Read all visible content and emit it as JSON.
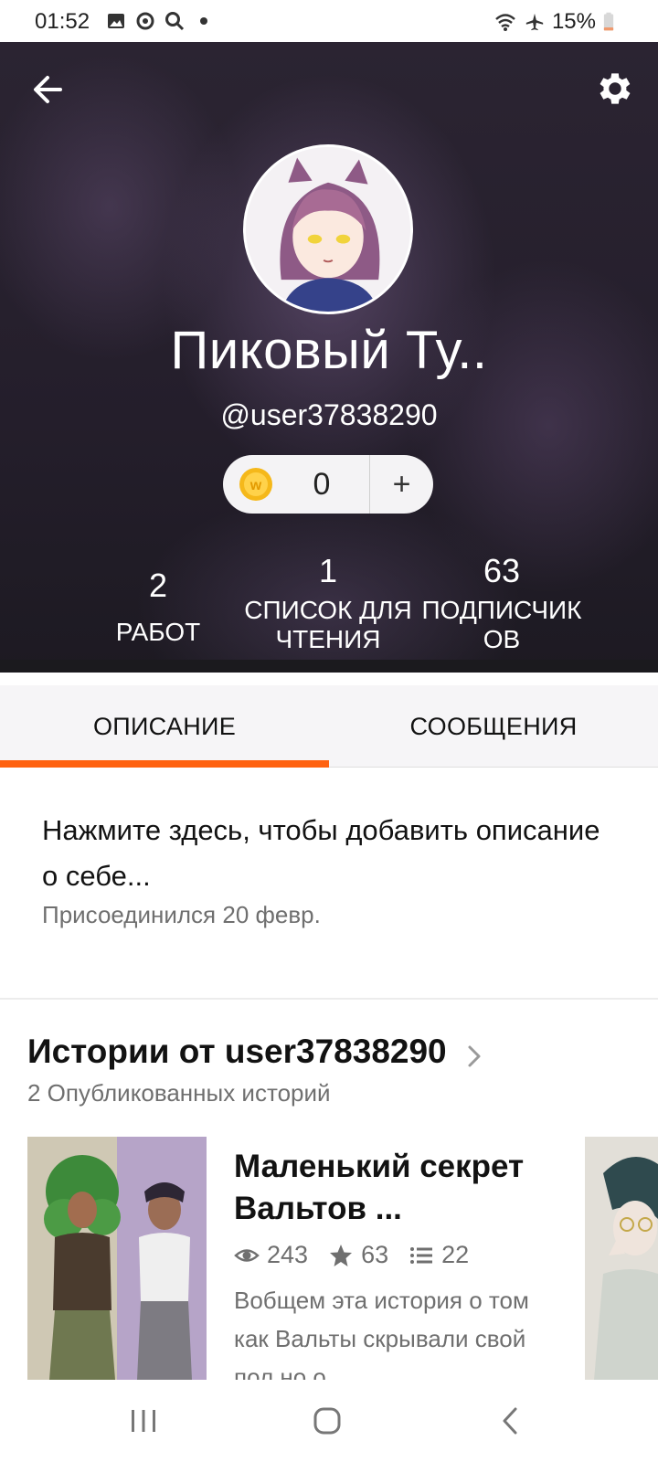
{
  "status_bar": {
    "time": "01:52",
    "battery": "15%",
    "icons": [
      "image-icon",
      "sync-icon",
      "search-icon",
      "dot-icon",
      "wifi-icon",
      "airplane-icon",
      "battery-icon"
    ]
  },
  "header": {
    "back_icon": "arrow-left-icon",
    "settings_icon": "gear-icon",
    "name": "Пиковый Ту..",
    "handle": "@user37838290",
    "coins": {
      "count": "0",
      "add_label": "+",
      "icon": "coin-icon"
    },
    "stats": {
      "works": {
        "value": "2",
        "label": "РАБОТ"
      },
      "reading_list": {
        "value": "1",
        "label_line1": "СПИСОК ДЛЯ",
        "label_line2": "ЧТЕНИЯ"
      },
      "followers": {
        "value": "63",
        "label_line1": "ПОДПИСЧИК",
        "label_line2": "ОВ"
      }
    }
  },
  "tabs": {
    "items": [
      {
        "label": "ОПИСАНИЕ",
        "active": true
      },
      {
        "label": "СООБЩЕНИЯ",
        "active": false
      }
    ],
    "accent_color": "#ff6210"
  },
  "description": {
    "prompt": "Нажмите здесь, чтобы добавить описание о себе...",
    "joined": "Присоединился 20 февр."
  },
  "stories": {
    "title": "Истории от user37838290",
    "subtitle": "2 Опубликованных историй",
    "items": [
      {
        "title": "Маленький секрет Вальтов ...",
        "reads": "243",
        "votes": "63",
        "parts": "22",
        "description": "Вобщем эта история о том как Вальты скрывали свой пол но о..."
      }
    ]
  },
  "nav_bar": {
    "icons": [
      "recent-apps-icon",
      "home-icon",
      "back-icon"
    ]
  }
}
